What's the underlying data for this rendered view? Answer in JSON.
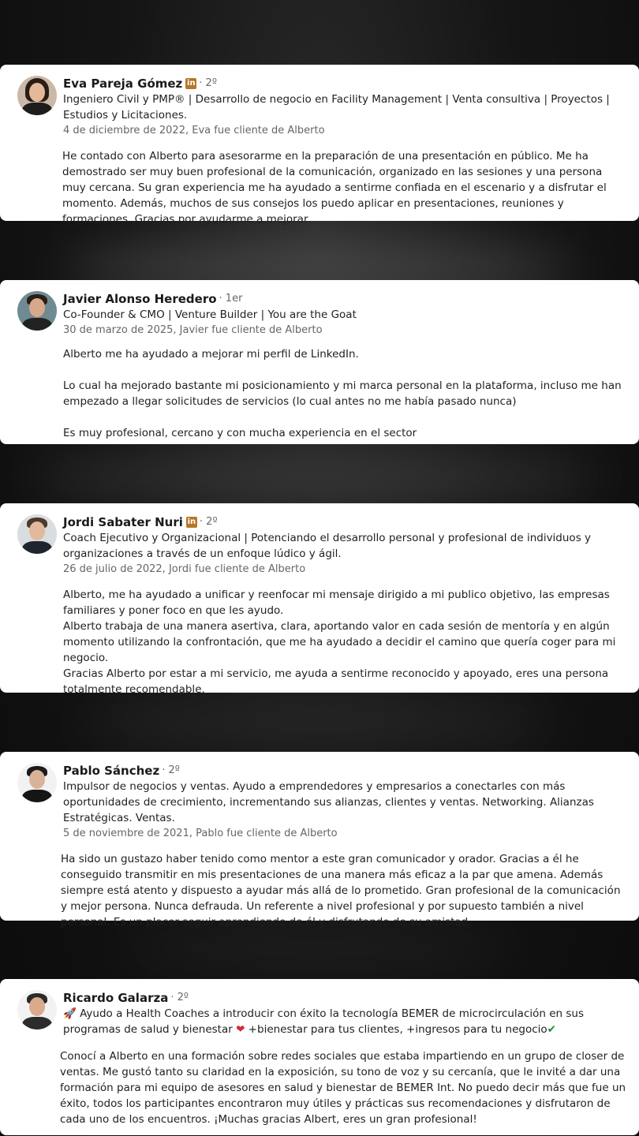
{
  "recommendations": [
    {
      "name": "Eva Pareja Gómez",
      "linkedin_badge": true,
      "degree": "· 2º",
      "headline": "Ingeniero Civil y PMP® | Desarrollo de negocio en Facility Management | Venta consultiva | Proyectos | Estudios y Licitaciones.",
      "date": "4 de diciembre de 2022, Eva fue cliente de Alberto",
      "text": "He contado con Alberto para asesorarme en la preparación de una presentación en público. Me ha demostrado ser muy buen profesional de la comunicación, organizado en las sesiones y una persona muy cercana. Su gran experiencia me ha ayudado a sentirme confiada en el escenario y a disfrutar el momento. Además, muchos de sus consejos los puedo aplicar en presentaciones, reuniones y formaciones. Gracias por ayudarme a mejorar."
    },
    {
      "name": "Javier Alonso Heredero",
      "linkedin_badge": false,
      "degree": "· 1er",
      "headline": "Co-Founder & CMO | Venture Builder | You are the Goat",
      "date": "30 de marzo de 2025, Javier fue cliente de Alberto",
      "text": "Alberto me ha ayudado a mejorar mi perfil de LinkedIn.\n\nLo cual ha mejorado bastante mi posicionamiento y mi marca personal en la plataforma, incluso me han empezado a llegar solicitudes de servicios (lo cual antes no me había pasado nunca)\n\nEs muy profesional, cercano y con mucha experiencia en el sector"
    },
    {
      "name": "Jordi Sabater Nuri",
      "linkedin_badge": true,
      "degree": "· 2º",
      "headline": "Coach Ejecutivo y Organizacional | Potenciando el desarrollo personal y profesional de individuos y organizaciones a través de un enfoque lúdico y ágil.",
      "date": "26 de julio de 2022, Jordi fue cliente de Alberto",
      "text": "Alberto, me ha ayudado a unificar y reenfocar mi mensaje dirigido a mi publico objetivo, las empresas familiares y poner foco en que les ayudo.\nAlberto trabaja de una manera asertiva, clara, aportando valor en cada sesión de mentoría y en algún momento utilizando la confrontación, que me ha ayudado a decidir el camino que quería coger para mi negocio.\nGracias Alberto por estar a mi servicio, me ayuda a sentirme reconocido y apoyado, eres una persona totalmente recomendable."
    },
    {
      "name": "Pablo Sánchez",
      "linkedin_badge": false,
      "degree": "· 2º",
      "headline": "Impulsor de negocios y ventas. Ayudo a emprendedores y empresarios a conectarles con más oportunidades de crecimiento, incrementando sus alianzas, clientes y ventas. Networking. Alianzas Estratégicas. Ventas.",
      "date": "5 de noviembre de 2021, Pablo fue cliente de Alberto",
      "text": "Ha sido un gustazo haber tenido como mentor a este gran comunicador y orador. Gracias a él he conseguido transmitir en mis presentaciones de una manera más eficaz a la par que amena. Además siempre está atento y dispuesto a ayudar más allá de lo prometido. Gran profesional de la comunicación y mejor persona. Nunca defrauda. Un referente a nivel profesional y por supuesto también a nivel personal. Es un placer seguir aprendiendo de él y disfrutando de su amistad."
    },
    {
      "name": "Ricardo Galarza",
      "linkedin_badge": false,
      "degree": "· 2º",
      "headline_parts": [
        "🚀 Ayudo a Health Coaches a introducir con éxito la tecnología BEMER de microcirculación en sus programas de salud y bienestar ",
        "❤",
        " +bienestar para tus clientes, +ingresos para tu negocio",
        "✔"
      ],
      "date": "",
      "text": "Conocí a Alberto en una formación sobre redes sociales que estaba impartiendo en un grupo de closer de ventas. Me gustó tanto su claridad en la exposición, su tono de voz y su cercanía, que le invité a dar una formación para mi equipo de asesores en salud y bienestar de BEMER Int. No puedo decir más que fue un éxito, todos los participantes encontraron muy útiles y prácticas sus recomendaciones y disfrutaron de cada uno de los encuentros. ¡Muchas gracias Albert, eres un gran profesional!"
    }
  ],
  "colors": {
    "card_bg": "#ffffff",
    "linkedin_badge": "#b7762a",
    "meta_text": "#666666"
  }
}
